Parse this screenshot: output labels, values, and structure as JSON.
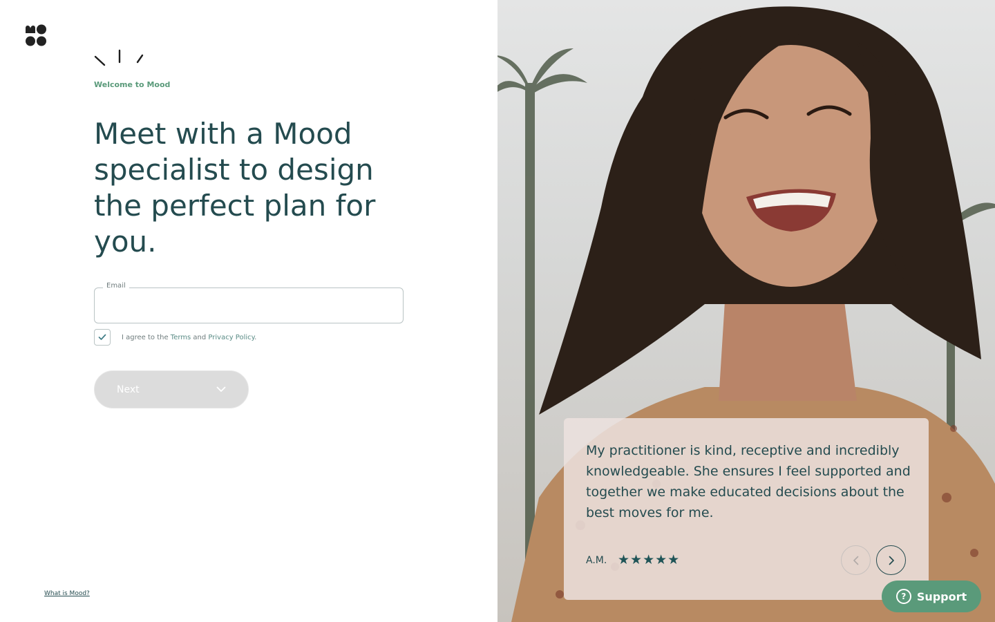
{
  "colors": {
    "brand_dark": "#244b4f",
    "accent_green": "#5a9a7a",
    "link_teal": "#5a8c86",
    "button_disabled": "#dcdcdc",
    "support_bg": "#5a9a7a"
  },
  "brand": {
    "logo_icon": "mood-logo-icon",
    "decoration_icon": "sun-rays-icon"
  },
  "hero": {
    "eyebrow": "Welcome to Mood",
    "headline": "Meet with a Mood specialist to design the perfect plan for you."
  },
  "form": {
    "email_label": "Email",
    "email_value": "",
    "agree_prefix": "I agree to the ",
    "terms_link": "Terms",
    "agree_and": " and ",
    "privacy_link": "Privacy Policy",
    "agree_suffix": ".",
    "agree_checked": true,
    "next_label": "Next",
    "next_icon": "chevron-down-icon"
  },
  "footer": {
    "what_is_link": "What is Mood?"
  },
  "testimonial": {
    "quote": "My practitioner is kind, receptive and incredibly knowledgeable. She ensures I feel supported and together we make educated decisions about the best moves for me.",
    "author": "A.M.",
    "rating": 5,
    "stars_text": "★★★★★",
    "prev_icon": "chevron-left-icon",
    "next_icon": "chevron-right-icon"
  },
  "support": {
    "label": "Support",
    "icon": "question-icon"
  }
}
